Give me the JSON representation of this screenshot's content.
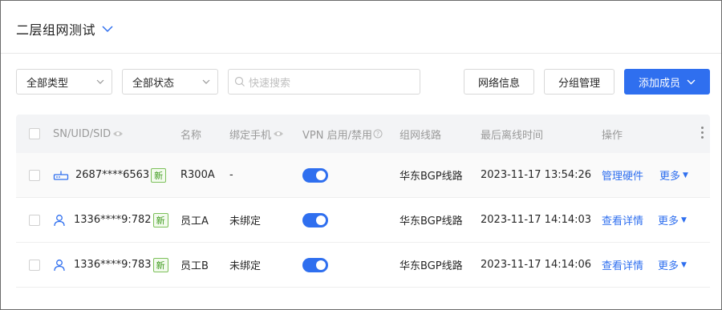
{
  "header": {
    "title": "二层组网测试"
  },
  "toolbar": {
    "type_filter": "全部类型",
    "status_filter": "全部状态",
    "search_placeholder": "快速搜索",
    "network_info": "网络信息",
    "group_manage": "分组管理",
    "add_member": "添加成员"
  },
  "table": {
    "columns": {
      "sn": "SN/UID/SID",
      "name": "名称",
      "phone": "绑定手机",
      "vpn": "VPN 启用/禁用",
      "line": "组网线路",
      "last_offline": "最后离线时间",
      "actions": "操作"
    },
    "rows": [
      {
        "id": "2687****6563",
        "tag": "新",
        "name": "R300A",
        "phone": "-",
        "vpn_enabled": true,
        "line": "华东BGP线路",
        "last_offline": "2023-11-17 13:54:26",
        "action": "管理硬件",
        "more": "更多",
        "icon": "router-icon"
      },
      {
        "id": "1336****9:782",
        "tag": "新",
        "name": "员工A",
        "phone": "未绑定",
        "vpn_enabled": true,
        "line": "华东BGP线路",
        "last_offline": "2023-11-17 14:14:03",
        "action": "查看详情",
        "more": "更多",
        "icon": "user-icon"
      },
      {
        "id": "1336****9:783",
        "tag": "新",
        "name": "员工B",
        "phone": "未绑定",
        "vpn_enabled": true,
        "line": "华东BGP线路",
        "last_offline": "2023-11-17 14:14:06",
        "action": "查看详情",
        "more": "更多",
        "icon": "user-icon"
      }
    ]
  },
  "colors": {
    "primary": "#2f6fef",
    "new_tag": "#3f9b1f"
  }
}
